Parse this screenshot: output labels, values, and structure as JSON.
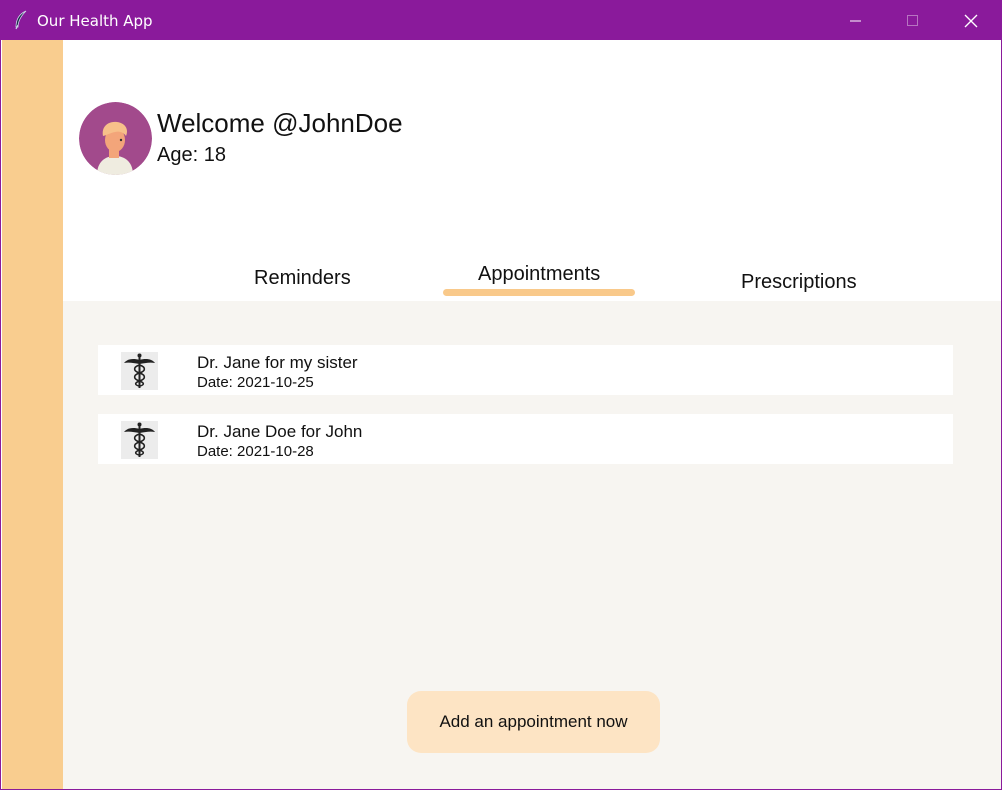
{
  "window": {
    "title": "Our Health App",
    "titlebar_color": "#8a1a9b"
  },
  "sidebar": {
    "color": "#f9cd8f"
  },
  "profile": {
    "welcome": "Welcome @JohnDoe",
    "age": "Age: 18"
  },
  "tabs": [
    {
      "label": "Reminders"
    },
    {
      "label": "Appointments",
      "selected": true
    },
    {
      "label": "Prescriptions"
    }
  ],
  "appointments": [
    {
      "name": "Dr. Jane for my sister",
      "date": "Date: 2021-10-25",
      "icon": "caduceus-icon"
    },
    {
      "name": "Dr. Jane Doe for John",
      "date": "Date: 2021-10-28",
      "icon": "caduceus-icon"
    }
  ],
  "actions": {
    "add_label": "Add an appointment now"
  },
  "colors": {
    "accent": "#f9c98a",
    "button_bg": "#fde4c4",
    "content_bg": "#f7f5f1"
  }
}
